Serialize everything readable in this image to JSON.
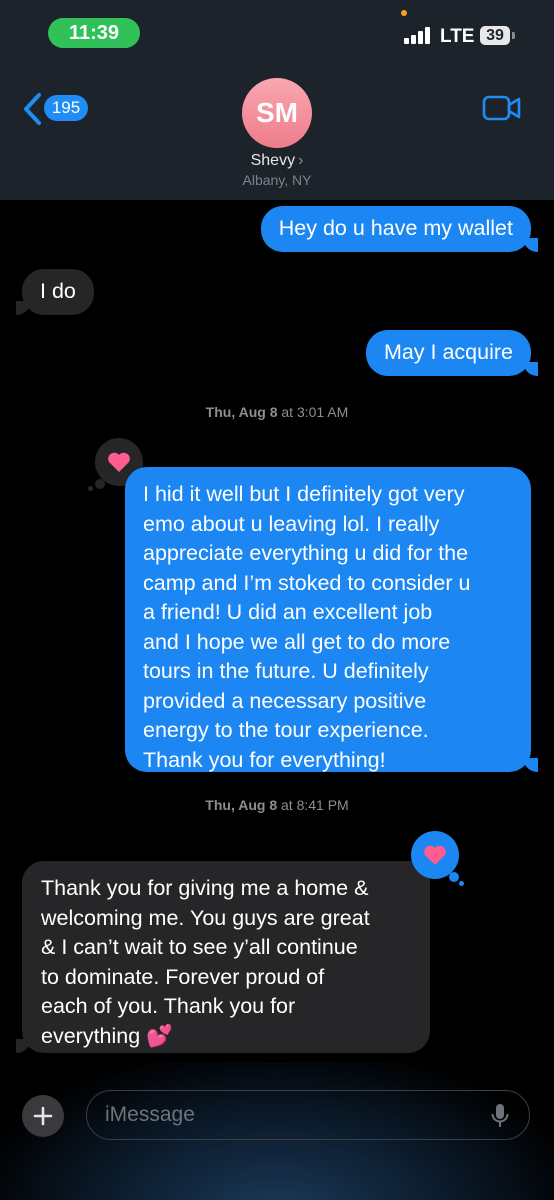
{
  "status_bar": {
    "time": "11:39",
    "network": "LTE",
    "battery": "39"
  },
  "header": {
    "back_count": "195",
    "avatar_initials": "SM",
    "contact_name": "Shevy",
    "contact_location": "Albany, NY",
    "icons": {
      "back": "chevron-left-icon",
      "video": "video-camera-icon"
    }
  },
  "messages": [
    {
      "direction": "outgoing",
      "text": "Hey do u have my wallet"
    },
    {
      "direction": "incoming",
      "text": "I do"
    },
    {
      "direction": "outgoing",
      "text": "May I acquire"
    }
  ],
  "timestamp_1": {
    "day": "Thu, Aug 8",
    "time": "at 3:01 AM"
  },
  "long_outgoing": {
    "text": "I hid it well but I definitely got very\nemo about u leaving lol. I really\nappreciate everything u did for the\ncamp and I’m stoked to consider u\na friend! U did an excellent job\nand I hope we all get to do more\ntours in the future.  U definitely\nprovided a necessary positive\nenergy to the tour experience.\nThank you for everything!",
    "reaction": "heart"
  },
  "timestamp_2": {
    "day": "Thu, Aug 8",
    "time": "at 8:41 PM"
  },
  "long_incoming": {
    "text": "Thank you for giving me a home &\nwelcoming me. You guys are great\n& I can’t wait to see y’all continue\nto dominate. Forever proud of\neach of you. Thank you for\neverything 💕",
    "reaction": "heart"
  },
  "input": {
    "placeholder": "iMessage",
    "icons": {
      "plus": "plus-icon",
      "mic": "microphone-icon"
    }
  },
  "colors": {
    "outgoing_bubble": "#1c87f3",
    "incoming_bubble": "#262629",
    "heart": "#ff5d8f",
    "time_pill": "#30c158"
  }
}
